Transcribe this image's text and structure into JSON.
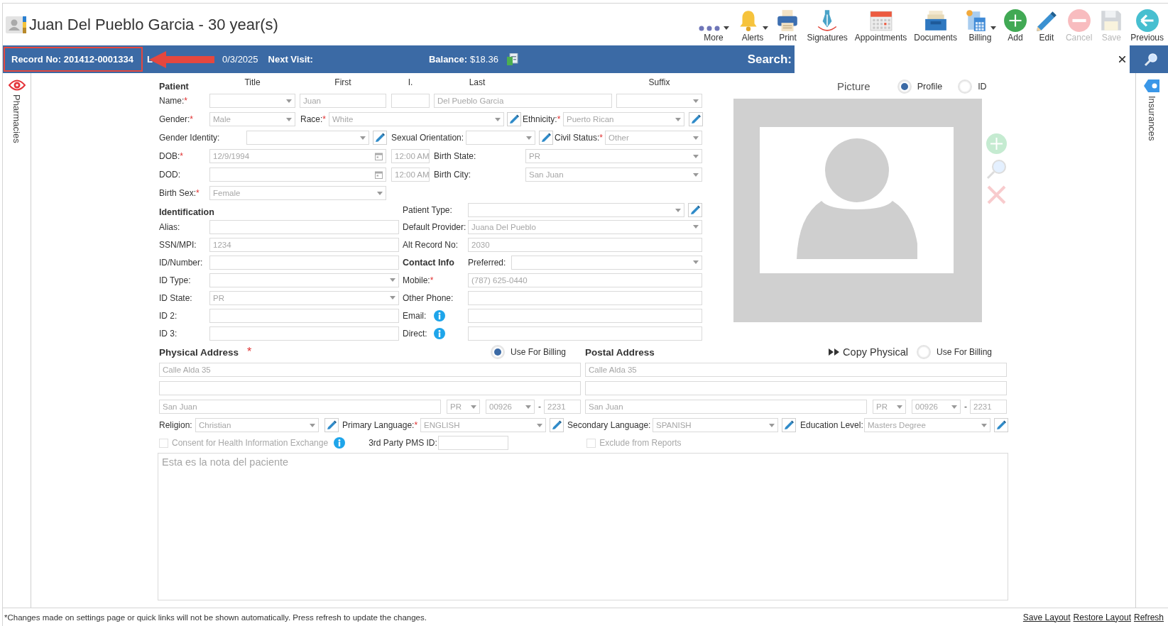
{
  "header": {
    "title": "Juan Del Pueblo Garcia - 30 year(s)"
  },
  "toolbar": [
    {
      "kind": "more",
      "label": "More",
      "menu": true,
      "disabled": false
    },
    {
      "kind": "alerts",
      "label": "Alerts",
      "menu": true,
      "disabled": false
    },
    {
      "kind": "print",
      "label": "Print",
      "menu": false,
      "disabled": false
    },
    {
      "kind": "signatures",
      "label": "Signatures",
      "menu": false,
      "disabled": false
    },
    {
      "kind": "appointments",
      "label": "Appointments",
      "menu": false,
      "disabled": false
    },
    {
      "kind": "documents",
      "label": "Documents",
      "menu": false,
      "disabled": false
    },
    {
      "kind": "billing",
      "label": "Billing",
      "menu": true,
      "disabled": false
    },
    {
      "kind": "add",
      "label": "Add",
      "menu": false,
      "disabled": false
    },
    {
      "kind": "edit",
      "label": "Edit",
      "menu": false,
      "disabled": false
    },
    {
      "kind": "cancel",
      "label": "Cancel",
      "menu": false,
      "disabled": true
    },
    {
      "kind": "save",
      "label": "Save",
      "menu": false,
      "disabled": true
    },
    {
      "kind": "previous",
      "label": "Previous",
      "menu": false,
      "disabled": false
    }
  ],
  "info_bar": {
    "record": "Record No: 201412-0001334",
    "last_visit_label": "L",
    "last_visit_value": "0/3/2025",
    "next_visit_label": "Next Visit:",
    "balance_label": "Balance:",
    "balance_value": "$18.36",
    "search_label": "Search:"
  },
  "annotations": [
    {
      "kind": "box"
    },
    {
      "kind": "arrow"
    }
  ],
  "required_mark": "*",
  "editable": false,
  "patient": {
    "heading": "Patient",
    "columns": [
      "Title",
      "First",
      "I.",
      "Last",
      "Suffix"
    ],
    "name": {
      "label": "Name:",
      "required": true,
      "fields": [
        {
          "kind": "select"
        },
        {
          "kind": "text",
          "value": "Juan"
        },
        {
          "kind": "text"
        },
        {
          "kind": "text",
          "value": "Del Pueblo Garcia"
        },
        {
          "kind": "select"
        }
      ]
    },
    "rows": [
      [
        {
          "kind": "label",
          "text": "Gender:",
          "required": true
        },
        {
          "kind": "select",
          "value": "Male"
        },
        {
          "kind": "label",
          "text": "Race:",
          "required": true
        },
        {
          "kind": "select",
          "value": "White"
        },
        {
          "kind": "pencil"
        },
        {
          "kind": "label",
          "text": "Ethnicity:",
          "required": true
        },
        {
          "kind": "select",
          "value": "Puerto Rican"
        },
        {
          "kind": "pencil"
        }
      ],
      [
        {
          "kind": "label",
          "text": "Gender Identity:",
          "required": false
        },
        {
          "kind": "select"
        },
        {
          "kind": "pencil"
        },
        {
          "kind": "label",
          "text": "Sexual Orientation:",
          "required": false
        },
        {
          "kind": "select"
        },
        {
          "kind": "pencil"
        },
        {
          "kind": "label",
          "text": "Civil Status:",
          "required": true
        },
        {
          "kind": "select",
          "value": "Other"
        }
      ],
      [
        {
          "kind": "label",
          "text": "DOB:",
          "required": true
        },
        {
          "kind": "date",
          "value": "12/9/1994"
        },
        {
          "kind": "time",
          "value": "12:00 AM"
        },
        {
          "kind": "label",
          "text": "Birth State:",
          "required": false
        },
        {
          "kind": "select",
          "value": "PR"
        }
      ],
      [
        {
          "kind": "label",
          "text": "DOD:",
          "required": false
        },
        {
          "kind": "date"
        },
        {
          "kind": "time",
          "value": "12:00 AM"
        },
        {
          "kind": "label",
          "text": "Birth City:",
          "required": false
        },
        {
          "kind": "select",
          "value": "San Juan"
        }
      ],
      [
        {
          "kind": "label",
          "text": "Birth Sex:",
          "required": true
        },
        {
          "kind": "select",
          "value": "Female"
        }
      ]
    ]
  },
  "identification": {
    "heading": "Identification",
    "rows": [
      [
        {
          "kind": "label",
          "text": "Alias:",
          "required": false
        },
        {
          "kind": "text"
        }
      ],
      [
        {
          "kind": "label",
          "text": "SSN/MPI:",
          "required": false
        },
        {
          "kind": "text",
          "value": "1234"
        }
      ],
      [
        {
          "kind": "label",
          "text": "ID/Number:",
          "required": false
        },
        {
          "kind": "text"
        }
      ],
      [
        {
          "kind": "label",
          "text": "ID Type:",
          "required": false
        },
        {
          "kind": "select"
        }
      ],
      [
        {
          "kind": "label",
          "text": "ID State:",
          "required": false
        },
        {
          "kind": "select",
          "value": "PR"
        }
      ],
      [
        {
          "kind": "label",
          "text": "ID 2:",
          "required": false
        },
        {
          "kind": "text"
        }
      ],
      [
        {
          "kind": "label",
          "text": "ID 3:",
          "required": false
        },
        {
          "kind": "text"
        }
      ]
    ]
  },
  "details": {
    "rows": [
      [
        {
          "kind": "label",
          "text": "Patient Type:",
          "required": false
        },
        {
          "kind": "select"
        },
        {
          "kind": "pencil"
        }
      ],
      [
        {
          "kind": "label",
          "text": "Default Provider:",
          "required": false
        },
        {
          "kind": "select",
          "value": "Juana Del Pueblo"
        }
      ],
      [
        {
          "kind": "label",
          "text": "Alt Record No:",
          "required": false
        },
        {
          "kind": "text",
          "value": "2030"
        }
      ],
      [
        {
          "kind": "heading",
          "text": "Contact Info"
        },
        {
          "kind": "label",
          "text": "Preferred:",
          "required": false
        },
        {
          "kind": "select"
        }
      ],
      [
        {
          "kind": "label",
          "text": "Mobile:",
          "required": true
        },
        {
          "kind": "text",
          "value": "(787) 625-0440"
        }
      ],
      [
        {
          "kind": "label",
          "text": "Other Phone:",
          "required": false
        },
        {
          "kind": "text"
        }
      ],
      [
        {
          "kind": "label",
          "text": "Email:",
          "required": false
        },
        {
          "kind": "info"
        },
        {
          "kind": "text"
        }
      ],
      [
        {
          "kind": "label",
          "text": "Direct:",
          "required": false
        },
        {
          "kind": "info"
        },
        {
          "kind": "text"
        }
      ]
    ]
  },
  "picture": {
    "title": "Picture",
    "options": [
      {
        "label": "Profile",
        "selected": true
      },
      {
        "label": "ID",
        "selected": false
      }
    ],
    "tools_disabled": true
  },
  "physical_address": {
    "title": "Physical Address",
    "required": true,
    "billing": {
      "label": "Use For Billing",
      "selected": true
    },
    "lines": [
      {
        "kind": "text",
        "value": "Calle Alda 35"
      },
      {
        "kind": "text"
      }
    ],
    "city_row": [
      {
        "kind": "text",
        "value": "San Juan"
      },
      {
        "kind": "select",
        "value": "PR"
      },
      {
        "kind": "select",
        "value": "00926"
      },
      {
        "kind": "dash",
        "text": "-"
      },
      {
        "kind": "text",
        "value": "2231"
      }
    ]
  },
  "postal_address": {
    "title": "Postal Address",
    "copy_label": "Copy Physical",
    "billing": {
      "label": "Use For Billing",
      "selected": false
    },
    "lines": [
      {
        "kind": "text",
        "value": "Calle Alda 35"
      },
      {
        "kind": "text"
      }
    ],
    "city_row": [
      {
        "kind": "text",
        "value": "San Juan"
      },
      {
        "kind": "select",
        "value": "PR"
      },
      {
        "kind": "select",
        "value": "00926"
      },
      {
        "kind": "dash",
        "text": "-"
      },
      {
        "kind": "text",
        "value": "2231"
      }
    ]
  },
  "demographics_row": [
    {
      "kind": "label",
      "text": "Religion:",
      "required": false
    },
    {
      "kind": "select",
      "value": "Christian"
    },
    {
      "kind": "pencil"
    },
    {
      "kind": "label",
      "text": "Primary Language:",
      "required": true
    },
    {
      "kind": "select",
      "value": "ENGLISH"
    },
    {
      "kind": "pencil"
    },
    {
      "kind": "label",
      "text": "Secondary Language:",
      "required": false
    },
    {
      "kind": "select",
      "value": "SPANISH"
    },
    {
      "kind": "pencil"
    },
    {
      "kind": "label",
      "text": "Education Level:",
      "required": false
    },
    {
      "kind": "select",
      "value": "Masters Degree"
    },
    {
      "kind": "pencil"
    }
  ],
  "consent_row": [
    {
      "kind": "checkbox",
      "label": "Consent for Health Information Exchange",
      "checked": false,
      "disabled": true
    },
    {
      "kind": "info"
    },
    {
      "kind": "label",
      "text": "3rd Party PMS ID:",
      "required": false
    },
    {
      "kind": "text"
    },
    {
      "kind": "checkbox",
      "label": "Exclude from Reports",
      "checked": false,
      "disabled": true
    }
  ],
  "notes": {
    "value": "Esta es la nota del paciente"
  },
  "side_tabs": {
    "left": "Pharmacies",
    "right": "Insurances"
  },
  "footer": {
    "note": "*Changes made on settings page or quick links will not be shown automatically. Press refresh to update the changes.",
    "links": [
      "Save Layout",
      "Restore Layout",
      "Refresh"
    ]
  }
}
